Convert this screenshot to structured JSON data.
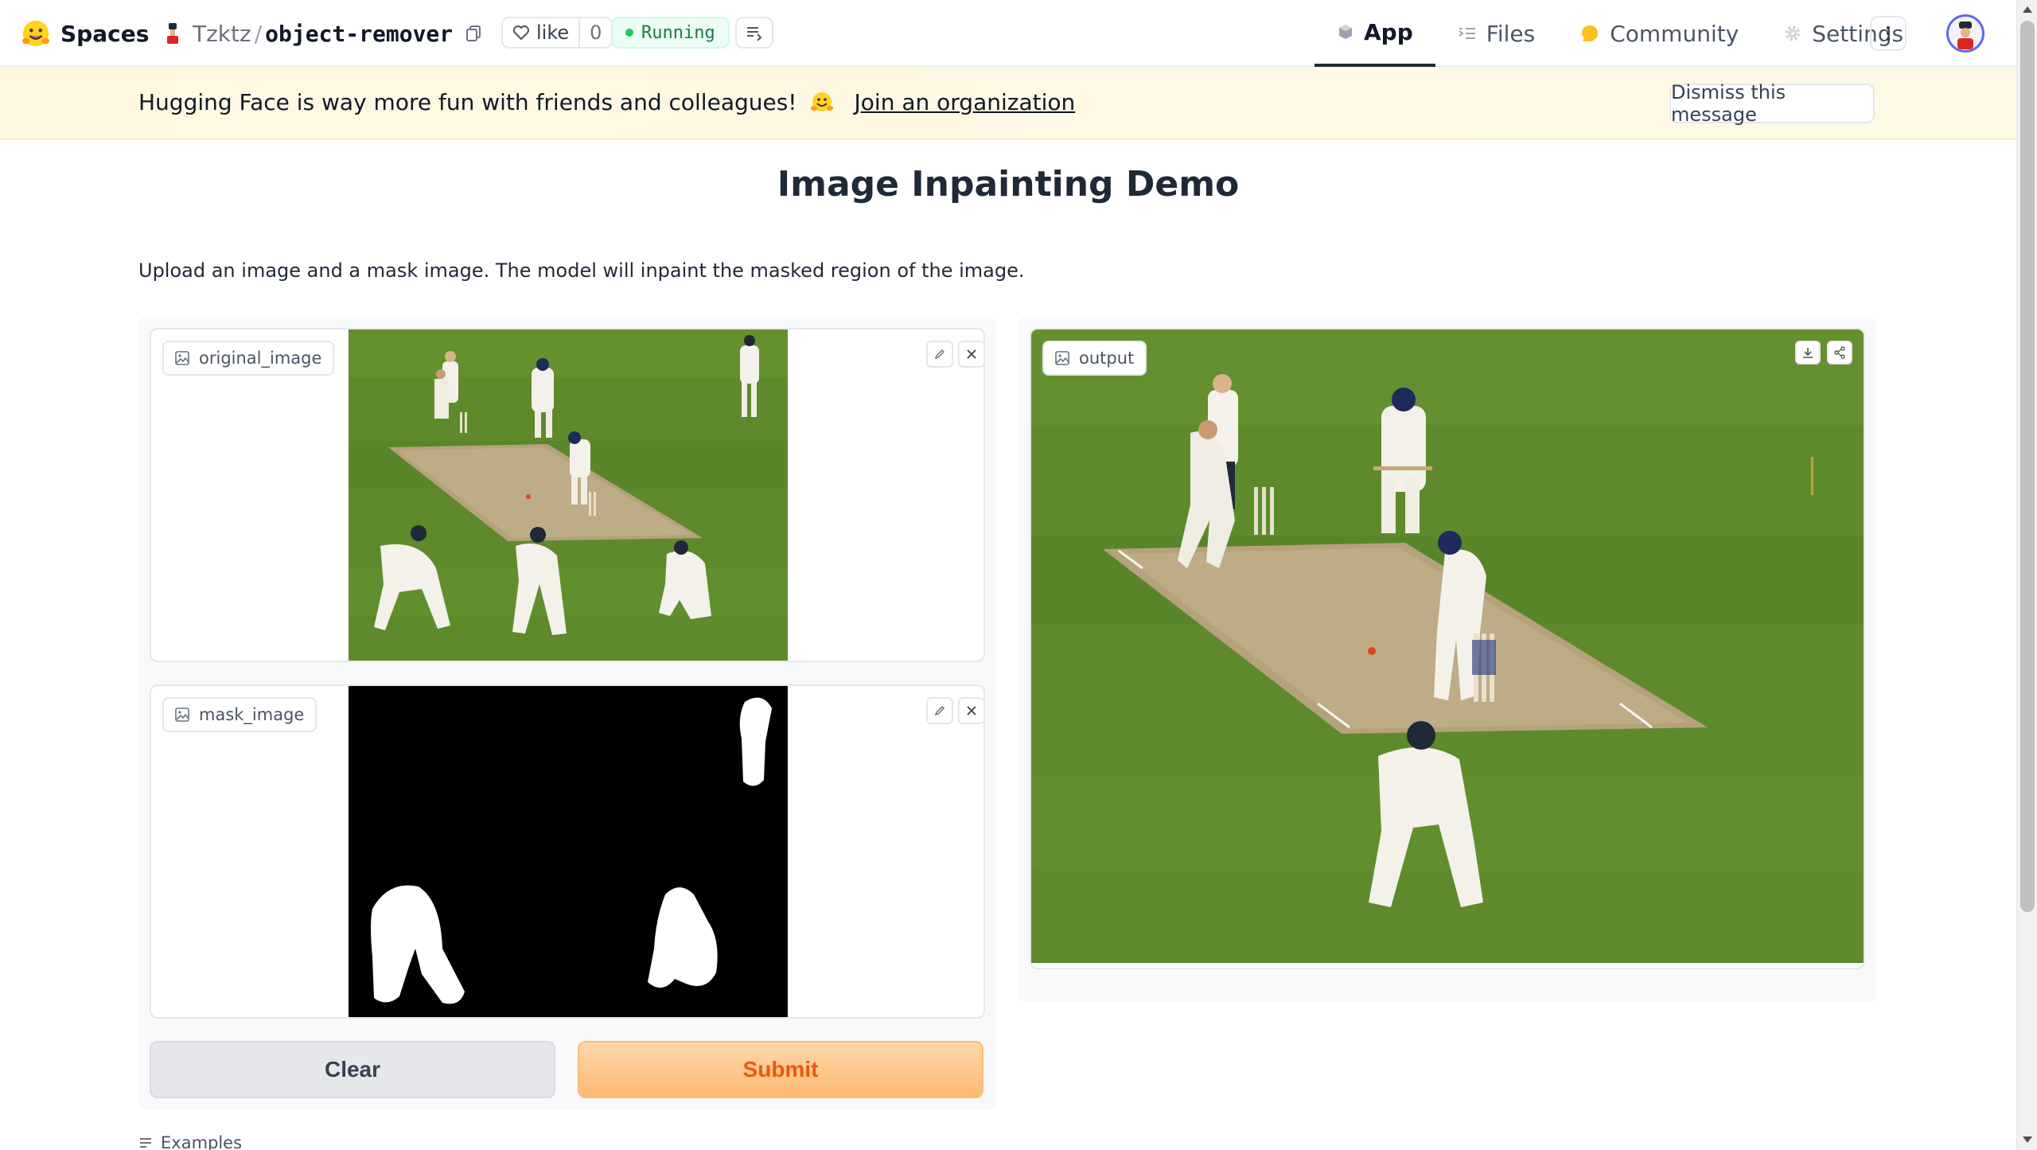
{
  "header": {
    "brand_label": "Spaces",
    "repo_owner": "Tzktz",
    "repo_separator": "/",
    "repo_name": "object-remover",
    "like_label": "like",
    "like_count": "0",
    "status_label": "Running",
    "tabs": [
      {
        "label": "App",
        "icon": "app-cube-icon",
        "active": true
      },
      {
        "label": "Files",
        "icon": "files-icon",
        "active": false
      },
      {
        "label": "Community",
        "icon": "community-icon",
        "active": false
      },
      {
        "label": "Settings",
        "icon": "gear-icon",
        "active": false
      }
    ]
  },
  "banner": {
    "message": "Hugging Face is way more fun with friends and colleagues!",
    "link_label": "Join an organization",
    "dismiss_label": "Dismiss this message"
  },
  "main": {
    "title": "Image Inpainting Demo",
    "description": "Upload an image and a mask image. The model will inpaint the masked region of the image.",
    "inputs": [
      {
        "label": "original_image"
      },
      {
        "label": "mask_image"
      }
    ],
    "output": {
      "label": "output"
    },
    "clear_label": "Clear",
    "submit_label": "Submit",
    "examples_label": "Examples"
  },
  "colors": {
    "accent": "#ea580c",
    "submit_bg": "#fdba74",
    "status_green": "#22c55e",
    "banner_bg": "#fff8e1",
    "grass": "#5e8a2c"
  }
}
